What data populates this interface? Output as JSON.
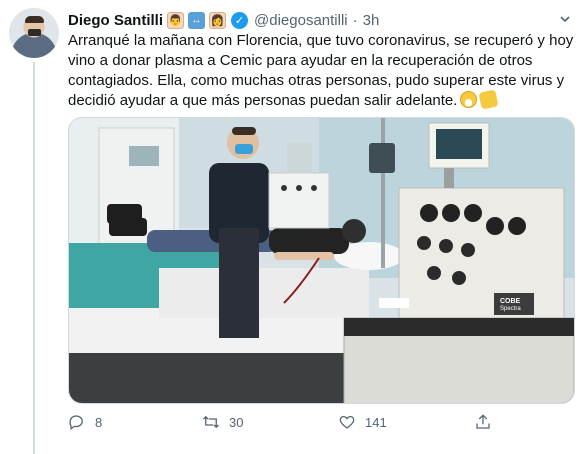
{
  "tweet": {
    "author_name": "Diego Santilli",
    "handle": "@diegosantilli",
    "separator": "·",
    "time": "3h",
    "name_emojis": [
      "man-technologist-emoji",
      "left-right-arrow-emoji",
      "woman-emoji"
    ],
    "verified": true,
    "text_lines": [
      "Arranqué la mañana con Florencia, que tuvo coronavirus, se recuperó y hoy",
      "vino a donar plasma a Cemic para ayudar en la recuperación de otros",
      "contagiados. Ella, como muchas otras personas, pudo superar este virus y",
      "decidió ayudar a que más personas puedan salir adelante."
    ],
    "trailing_emojis": [
      "face-with-medical-mask-emoji",
      "clapping-hands-emoji"
    ],
    "photo_labels": {
      "machine_brand": "COBE",
      "machine_model": "Spectra"
    }
  },
  "actions": {
    "reply_count": "8",
    "retweet_count": "30",
    "like_count": "141",
    "share_label": ""
  },
  "colors": {
    "accent": "#1d9bf0",
    "muted_text": "#536471",
    "text": "#0f1419",
    "border": "#cfd9de"
  }
}
